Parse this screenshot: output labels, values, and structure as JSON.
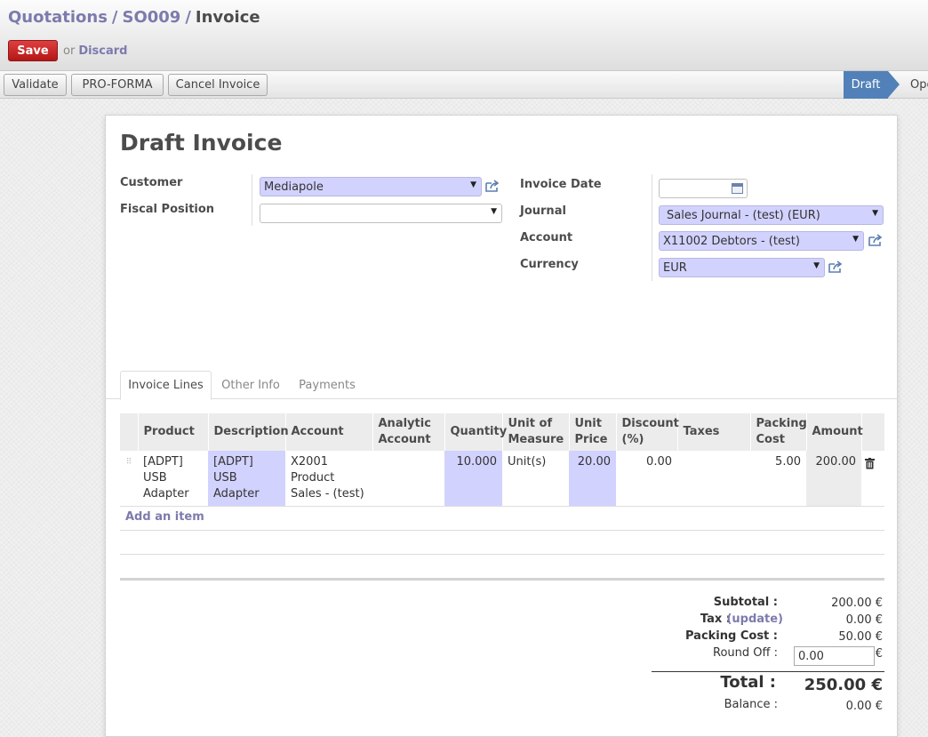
{
  "breadcrumb": {
    "items": [
      "Quotations",
      "SO009"
    ],
    "current": "Invoice"
  },
  "actions": {
    "save": "Save",
    "or": "or",
    "discard": "Discard"
  },
  "statusbar": {
    "buttons": [
      "Validate",
      "PRO-FORMA",
      "Cancel Invoice"
    ],
    "stages": [
      "Draft",
      "Ope"
    ],
    "active_stage": "Draft",
    "active_color": "#5181b8"
  },
  "form": {
    "title": "Draft Invoice",
    "customer_label": "Customer",
    "customer": "Mediapole",
    "fiscal_position_label": "Fiscal Position",
    "fiscal_position": "",
    "invoice_date_label": "Invoice Date",
    "invoice_date": "",
    "journal_label": "Journal",
    "journal": "Sales Journal - (test) (EUR)",
    "account_label": "Account",
    "account": "X11002 Debtors - (test)",
    "currency_label": "Currency",
    "currency": "EUR"
  },
  "tabs": [
    "Invoice Lines",
    "Other Info",
    "Payments"
  ],
  "lines": {
    "columns": [
      [
        "Product"
      ],
      [
        "Description"
      ],
      [
        "Account"
      ],
      [
        "Analytic",
        "Account"
      ],
      [
        "Quantity"
      ],
      [
        "Unit of",
        "Measure"
      ],
      [
        "Unit",
        "Price"
      ],
      [
        "Discount",
        "(%)"
      ],
      [
        "Taxes"
      ],
      [
        "Packing",
        "Cost"
      ],
      [
        "Amount"
      ]
    ],
    "rows": [
      {
        "product": [
          "[ADPT]",
          "USB",
          "Adapter"
        ],
        "description": [
          "[ADPT] USB",
          "Adapter"
        ],
        "account": [
          "X2001 Product",
          "Sales - (test)"
        ],
        "analytic_account": "",
        "quantity": "10.000",
        "uom": "Unit(s)",
        "unit_price": "20.00",
        "discount": "0.00",
        "taxes": "",
        "packing_cost": "5.00",
        "amount": "200.00"
      }
    ],
    "add_item": "Add an item"
  },
  "totals": {
    "subtotal_label": "Subtotal :",
    "subtotal": "200.00 €",
    "tax_label": "Tax :",
    "tax_update": "(update)",
    "tax": "0.00 €",
    "packing_label": "Packing Cost :",
    "packing": "50.00 €",
    "roundoff_label": "Round Off :",
    "roundoff": "0.00",
    "roundoff_currency": "€",
    "total_label": "Total :",
    "total": "250.00 €",
    "balance_label": "Balance :",
    "balance": "0.00 €"
  },
  "colors": {
    "save_button": "#c81e1e",
    "link": "#7c7bad",
    "required_field": "#d2d2ff"
  }
}
